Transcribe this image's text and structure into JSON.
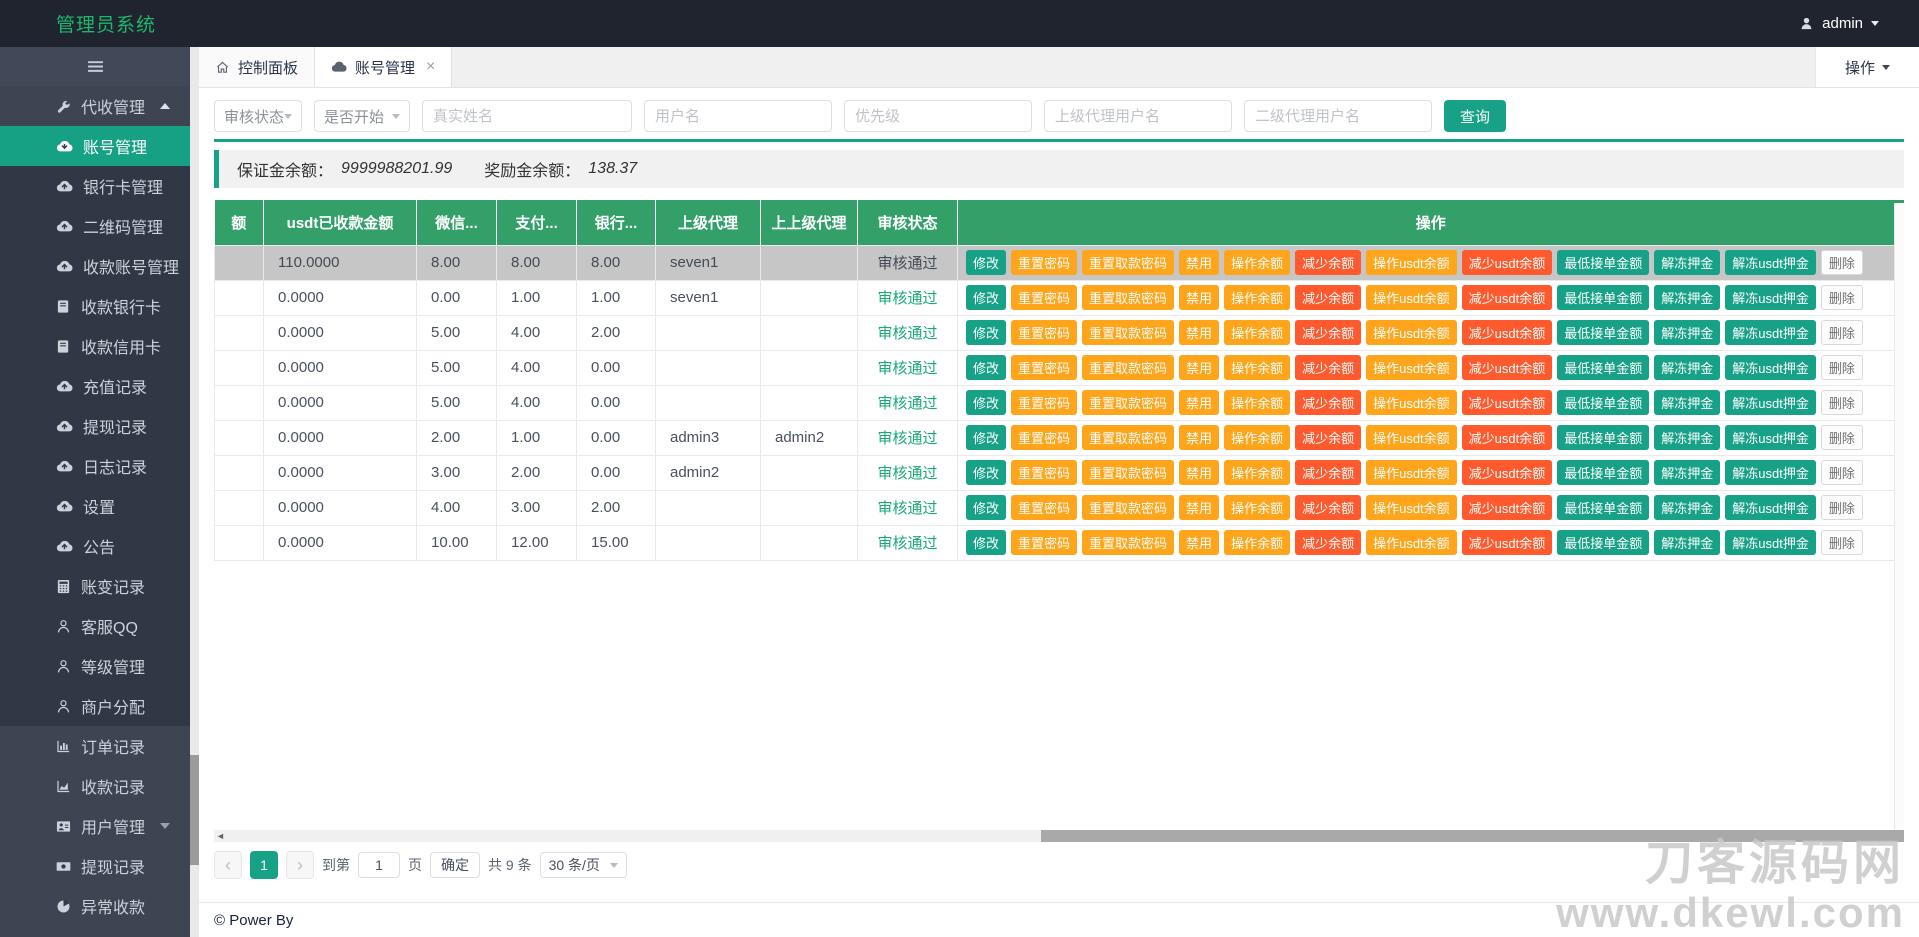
{
  "topbar": {
    "brand": "管理员系统",
    "username": "admin"
  },
  "sidebar": {
    "items": [
      {
        "id": "collection-management",
        "label": "代收管理",
        "icon": "wrench",
        "level": "top",
        "arrow": "up"
      },
      {
        "id": "account-management",
        "label": "账号管理",
        "icon": "cloud-down",
        "level": "sub",
        "active": true
      },
      {
        "id": "bankcard-management",
        "label": "银行卡管理",
        "icon": "cloud-up",
        "level": "sub"
      },
      {
        "id": "qrcode-management",
        "label": "二维码管理",
        "icon": "cloud-up",
        "level": "sub"
      },
      {
        "id": "receiving-account-management",
        "label": "收款账号管理",
        "icon": "cloud-up",
        "level": "sub"
      },
      {
        "id": "receiving-bankcard",
        "label": "收款银行卡",
        "icon": "book",
        "level": "sub"
      },
      {
        "id": "receiving-creditcard",
        "label": "收款信用卡",
        "icon": "book",
        "level": "sub"
      },
      {
        "id": "recharge-records",
        "label": "充值记录",
        "icon": "cloud-up",
        "level": "sub"
      },
      {
        "id": "withdraw-records",
        "label": "提现记录",
        "icon": "cloud-up",
        "level": "sub"
      },
      {
        "id": "log-records",
        "label": "日志记录",
        "icon": "cloud-up",
        "level": "sub"
      },
      {
        "id": "settings",
        "label": "设置",
        "icon": "cloud-up",
        "level": "sub"
      },
      {
        "id": "announcement",
        "label": "公告",
        "icon": "cloud-up",
        "level": "sub"
      },
      {
        "id": "balance-change-records",
        "label": "账变记录",
        "icon": "calculator",
        "level": "sub"
      },
      {
        "id": "service-qq",
        "label": "客服QQ",
        "icon": "person",
        "level": "sub"
      },
      {
        "id": "level-management",
        "label": "等级管理",
        "icon": "person",
        "level": "sub"
      },
      {
        "id": "merchant-allocation",
        "label": "商户分配",
        "icon": "person",
        "level": "sub"
      },
      {
        "id": "order-records",
        "label": "订单记录",
        "icon": "bar-chart",
        "level": "top"
      },
      {
        "id": "receiving-records",
        "label": "收款记录",
        "icon": "area-chart",
        "level": "top"
      },
      {
        "id": "user-management",
        "label": "用户管理",
        "icon": "user-card",
        "level": "top",
        "arrow": "down"
      },
      {
        "id": "withdraw-records-2",
        "label": "提现记录",
        "icon": "money",
        "level": "top"
      },
      {
        "id": "abnormal-receiving",
        "label": "异常收款",
        "icon": "pie",
        "level": "top"
      }
    ]
  },
  "tabs": [
    {
      "label": "控制面板"
    },
    {
      "label": "账号管理"
    }
  ],
  "actions_menu": {
    "label": "操作"
  },
  "filters": {
    "fields": [
      {
        "kind": "select",
        "text": "审核状态"
      },
      {
        "kind": "select",
        "text": "是否开始"
      },
      {
        "kind": "input",
        "placeholder": "真实姓名"
      },
      {
        "kind": "input",
        "placeholder": "用户名"
      },
      {
        "kind": "input",
        "placeholder": "优先级"
      },
      {
        "kind": "input",
        "placeholder": "上级代理用户名"
      },
      {
        "kind": "input",
        "placeholder": "二级代理用户名"
      }
    ],
    "search_label": "查询"
  },
  "summary": {
    "label1": "保证金余额：",
    "value1": "9999988201.99",
    "label2": "奖励金余额：",
    "value2": "138.37"
  },
  "table": {
    "headers": [
      "额",
      "usdt已收款金额",
      "微信...",
      "支付...",
      "银行...",
      "上级代理",
      "上上级代理",
      "审核状态",
      "操作"
    ],
    "rows": [
      {
        "cells": [
          "",
          "110.0000",
          "8.00",
          "8.00",
          "8.00",
          "seven1",
          ""
        ],
        "status": "审核通过",
        "selected": true
      },
      {
        "cells": [
          "",
          "0.0000",
          "0.00",
          "1.00",
          "1.00",
          "seven1",
          ""
        ],
        "status": "审核通过"
      },
      {
        "cells": [
          "",
          "0.0000",
          "5.00",
          "4.00",
          "2.00",
          "",
          ""
        ],
        "status": "审核通过"
      },
      {
        "cells": [
          "",
          "0.0000",
          "5.00",
          "4.00",
          "0.00",
          "",
          ""
        ],
        "status": "审核通过"
      },
      {
        "cells": [
          "",
          "0.0000",
          "5.00",
          "4.00",
          "0.00",
          "",
          ""
        ],
        "status": "审核通过"
      },
      {
        "cells": [
          "",
          "0.0000",
          "2.00",
          "1.00",
          "0.00",
          "admin3",
          "admin2"
        ],
        "status": "审核通过"
      },
      {
        "cells": [
          "",
          "0.0000",
          "3.00",
          "2.00",
          "0.00",
          "admin2",
          ""
        ],
        "status": "审核通过"
      },
      {
        "cells": [
          "",
          "0.0000",
          "4.00",
          "3.00",
          "2.00",
          "",
          ""
        ],
        "status": "审核通过"
      },
      {
        "cells": [
          "",
          "0.0000",
          "10.00",
          "12.00",
          "15.00",
          "",
          ""
        ],
        "status": "审核通过"
      }
    ],
    "row_actions": [
      {
        "label": "修改",
        "style": "teal"
      },
      {
        "label": "重置密码",
        "style": "orange"
      },
      {
        "label": "重置取款密码",
        "style": "orange"
      },
      {
        "label": "禁用",
        "style": "orange"
      },
      {
        "label": "操作余额",
        "style": "orange"
      },
      {
        "label": "减少余额",
        "style": "red"
      },
      {
        "label": "操作usdt余额",
        "style": "orange"
      },
      {
        "label": "减少usdt余额",
        "style": "red"
      },
      {
        "label": "最低接单金额",
        "style": "teal"
      },
      {
        "label": "解冻押金",
        "style": "teal"
      },
      {
        "label": "解冻usdt押金",
        "style": "teal"
      },
      {
        "label": "删除",
        "style": "plain"
      }
    ]
  },
  "scrollbar": {
    "left_arrow": "◄"
  },
  "pagination": {
    "prev": "‹",
    "current": "1",
    "next": "›",
    "goto_label": "到第",
    "goto_value": "1",
    "page_unit": "页",
    "confirm_label": "确定",
    "total_text": "共 9 条",
    "per_page_text": "30 条/页"
  },
  "footer": {
    "text": "© Power By"
  },
  "watermark": {
    "line1": "刀客源码网",
    "line2": "www.dkewl.com"
  },
  "colors": {
    "accent_teal": "#17a288",
    "table_header_green": "#33a06a",
    "sidebar_active_green": "#16a185",
    "button_orange": "#ffa51b",
    "button_red": "#ff5a2e",
    "status_green": "#19a974",
    "brand_green": "#1bb76e",
    "selected_row_gray": "#c6c6c6"
  }
}
